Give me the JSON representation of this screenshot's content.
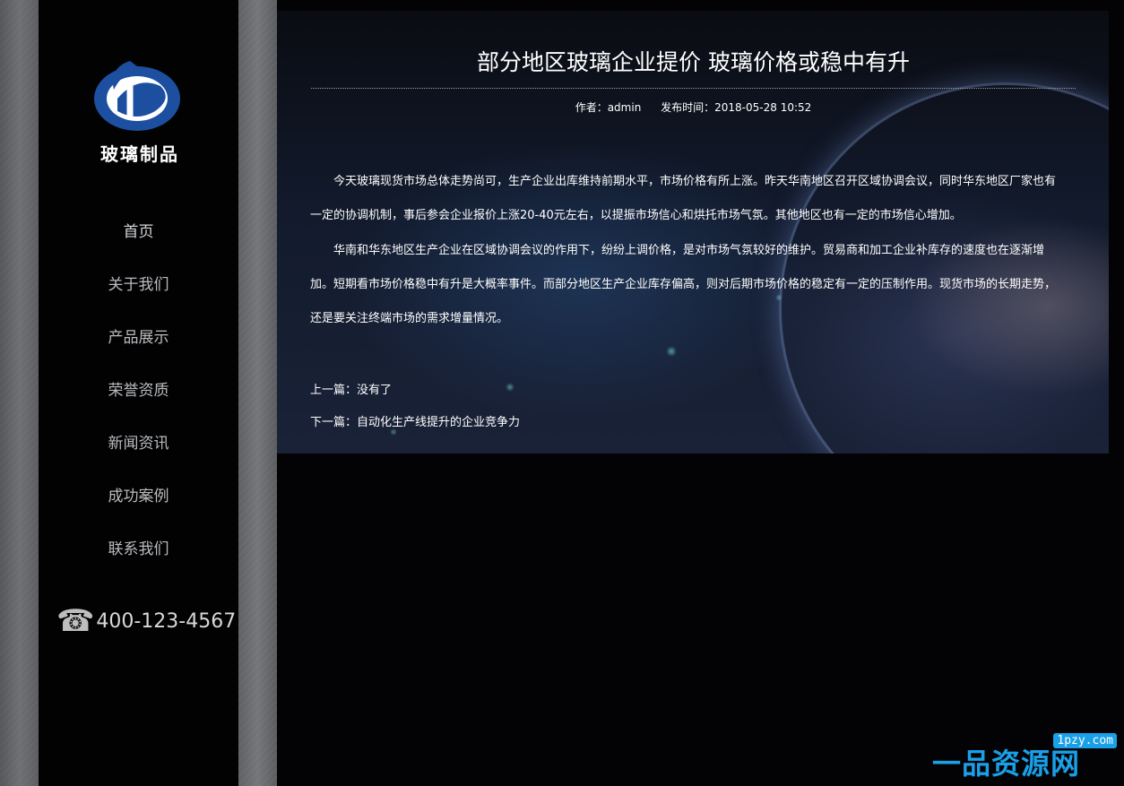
{
  "sidebar": {
    "logo_text": "玻璃制品",
    "nav": [
      "首页",
      "关于我们",
      "产品展示",
      "荣誉资质",
      "新闻资讯",
      "成功案例",
      "联系我们"
    ],
    "phone_icon": "phone-icon",
    "phone": "400-123-4567"
  },
  "article": {
    "title": "部分地区玻璃企业提价 玻璃价格或稳中有升",
    "author": "作者：admin",
    "published": "发布时间：2018-05-28 10:52",
    "paragraphs": [
      "今天玻璃现货市场总体走势尚可，生产企业出库维持前期水平，市场价格有所上涨。昨天华南地区召开区域协调会议，同时华东地区厂家也有一定的协调机制，事后参会企业报价上涨20-40元左右，以提振市场信心和烘托市场气氛。其他地区也有一定的市场信心增加。",
      "华南和华东地区生产企业在区域协调会议的作用下，纷纷上调价格，是对市场气氛较好的维护。贸易商和加工企业补库存的速度也在逐渐增加。短期看市场价格稳中有升是大概率事件。而部分地区生产企业库存偏高，则对后期市场价格的稳定有一定的压制作用。现货市场的长期走势，还是要关注终端市场的需求增量情况。"
    ],
    "prev": "上一篇：没有了",
    "next": "下一篇：自动化生产线提升的企业竞争力"
  },
  "watermark": {
    "url": "1pzy.com",
    "text": "一品资源网"
  },
  "colors": {
    "sidebar_bg": "#020203",
    "nav_text": "#b9bbbe",
    "logo_blue": "#1d4fa0",
    "watermark_blue": "#1aa0e8"
  }
}
